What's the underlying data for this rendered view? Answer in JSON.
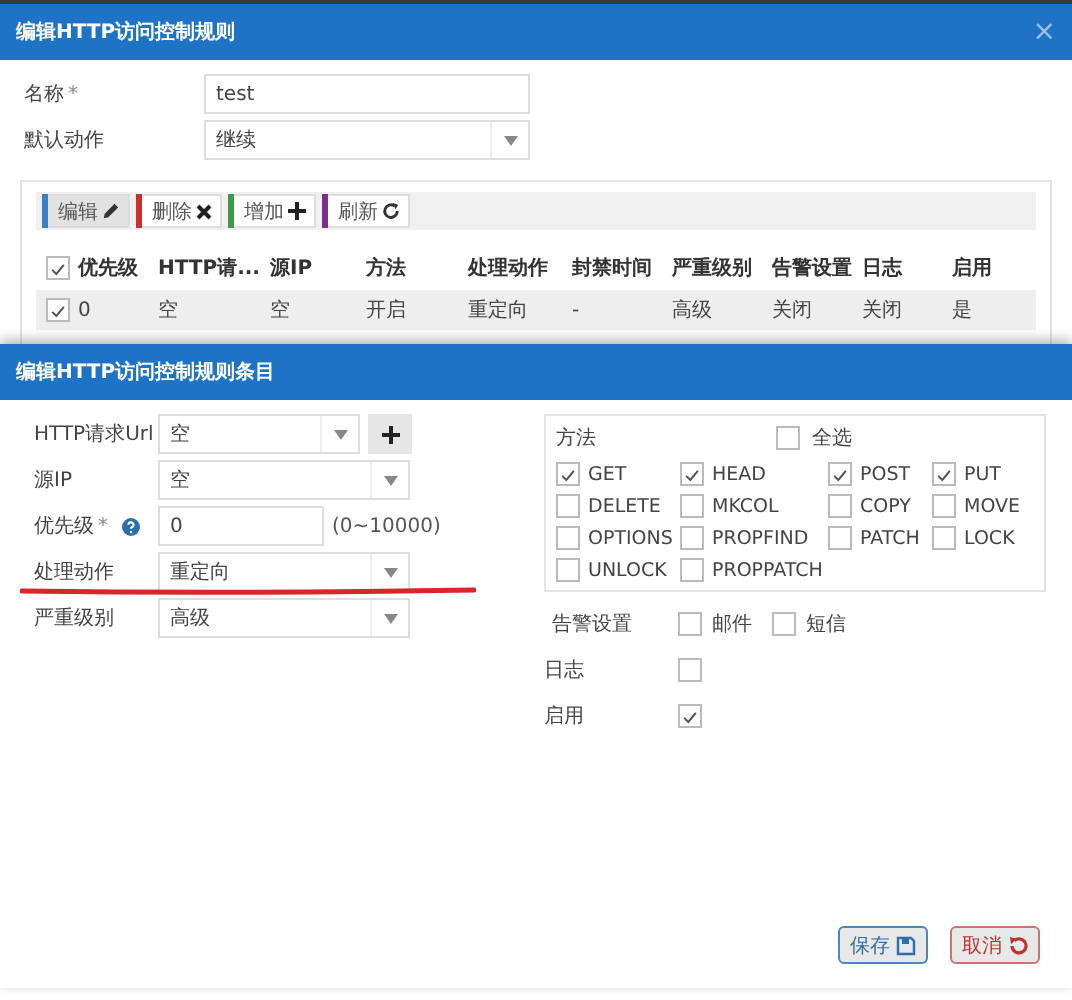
{
  "dialog": {
    "title": "编辑HTTP访问控制规则",
    "close": "×"
  },
  "form": [
    {
      "label": "名称",
      "mark": "*",
      "kind": "text",
      "value": "test"
    },
    {
      "label": "默认动作",
      "kind": "select",
      "value": "继续"
    }
  ],
  "toolbar": [
    {
      "label": "编辑",
      "kind": "edit",
      "color": "#3b7fc4",
      "selected": true
    },
    {
      "label": "删除",
      "kind": "delete",
      "color": "#c9302c",
      "selected": false
    },
    {
      "label": "增加",
      "kind": "add",
      "color": "#3c9a4a",
      "selected": false
    },
    {
      "label": "刷新",
      "kind": "refresh",
      "color": "#7b2f8f",
      "selected": false
    }
  ],
  "table": {
    "header_checked": true,
    "columns": [
      "优先级",
      "HTTP请...",
      "源IP",
      "方法",
      "处理动作",
      "封禁时间",
      "严重级别",
      "告警设置",
      "日志",
      "启用"
    ],
    "rows": [
      {
        "checked": true,
        "cells": [
          "0",
          "空",
          "空",
          "开启",
          "重定向",
          "-",
          "高级",
          "关闭",
          "关闭",
          "是"
        ]
      }
    ]
  },
  "entry_dialog": {
    "title": "编辑HTTP访问控制规则条目",
    "fields": [
      {
        "label": "HTTP请求Url",
        "kind": "select-add",
        "value": "空"
      },
      {
        "label": "源IP",
        "kind": "select",
        "value": "空"
      },
      {
        "label": "优先级",
        "mark": "*",
        "help": true,
        "kind": "number",
        "value": "0",
        "hint": "(0~10000)"
      },
      {
        "label": "处理动作",
        "kind": "select",
        "value": "重定向"
      },
      {
        "label": "严重级别",
        "kind": "select",
        "value": "高级"
      }
    ],
    "methods": {
      "label": "方法",
      "select_all": {
        "label": "全选",
        "checked": false
      },
      "items": [
        {
          "label": "GET",
          "checked": true
        },
        {
          "label": "HEAD",
          "checked": true
        },
        {
          "label": "POST",
          "checked": true
        },
        {
          "label": "PUT",
          "checked": true
        },
        {
          "label": "DELETE",
          "checked": false
        },
        {
          "label": "MKCOL",
          "checked": false
        },
        {
          "label": "COPY",
          "checked": false
        },
        {
          "label": "MOVE",
          "checked": false
        },
        {
          "label": "OPTIONS",
          "checked": false
        },
        {
          "label": "PROPFIND",
          "checked": false
        },
        {
          "label": "PATCH",
          "checked": false
        },
        {
          "label": "LOCK",
          "checked": false
        },
        {
          "label": "UNLOCK",
          "checked": false
        },
        {
          "label": "PROPPATCH",
          "checked": false
        }
      ]
    },
    "alarm": {
      "label": "告警设置",
      "options": [
        {
          "label": "邮件",
          "checked": false
        },
        {
          "label": "短信",
          "checked": false
        }
      ]
    },
    "log": {
      "label": "日志",
      "checked": false
    },
    "enabled": {
      "label": "启用",
      "checked": true
    },
    "buttons": [
      {
        "label": "保存",
        "kind": "save"
      },
      {
        "label": "取消",
        "kind": "cancel"
      }
    ]
  }
}
